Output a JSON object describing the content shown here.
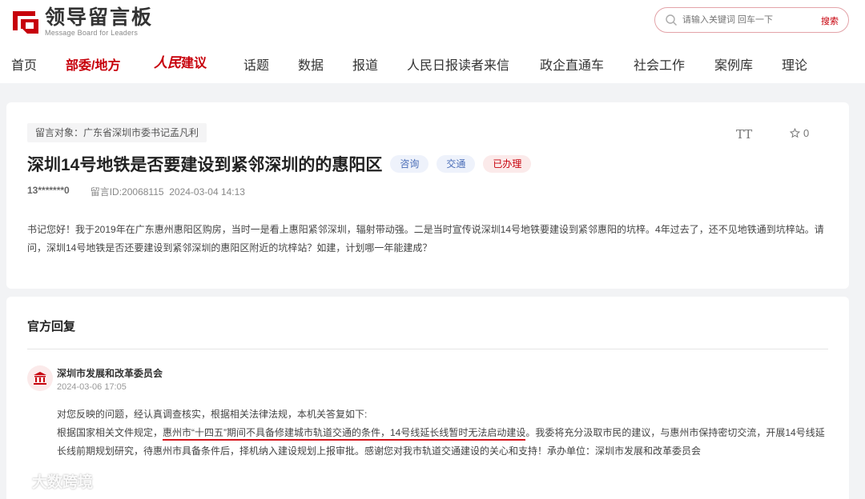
{
  "header": {
    "logo_cn": "领导留言板",
    "logo_en": "Message Board for Leaders",
    "search_placeholder": "请输入关键词 回车一下",
    "search_button": "搜索"
  },
  "nav": {
    "items": [
      "首页",
      "部委/地方",
      "人民建议",
      "话题",
      "数据",
      "报道",
      "人民日报读者来信",
      "政企直通车",
      "社会工作",
      "案例库",
      "理论"
    ],
    "brand_part1": "人民",
    "brand_part2": "建议"
  },
  "message": {
    "target": "留言对象：广东省深圳市委书记孟凡利",
    "font_tool": "TT",
    "favorite_count": "0",
    "title": "深圳14号地铁是否要建设到紧邻深圳的的惠阳区",
    "tags": [
      "咨询",
      "交通",
      "已办理"
    ],
    "author": "13*******0",
    "message_id": "留言ID:20068115",
    "date": "2024-03-04 14:13",
    "body": "书记您好！我于2019年在广东惠州惠阳区购房，当时一是看上惠阳紧邻深圳，辐射带动强。二是当时宣传说深圳14号地铁要建设到紧邻惠阳的坑梓。4年过去了，还不见地铁通到坑梓站。请问，深圳14号地铁是否还要建设到紧邻深圳的惠阳区附近的坑梓站？如建，计划哪一年能建成？"
  },
  "reply": {
    "section_title": "官方回复",
    "org": "深圳市发展和改革委员会",
    "date": "2024-03-06 17:05",
    "line1": "对您反映的问题，经认真调查核实，根据相关法律法规，本机关答复如下:",
    "p2_before": "根据国家相关文件规定，",
    "p2_underlined": "惠州市“十四五”期间不具备修建城市轨道交通的条件，14号线延长线暂时无法启动建设",
    "p2_after": "。我委将充分汲取市民的建议，与惠州市保持密切交流，开展14号线延长线前期规划研究，待惠州市具备条件后，择机纳入建设规划上报审批。感谢您对我市轨道交通建设的关心和支持！承办单位：深圳市发展和改革委员会"
  },
  "watermark": "大数跨境",
  "colors": {
    "brand_red": "#c7000b",
    "tag_blue": "#4b6eb8"
  }
}
